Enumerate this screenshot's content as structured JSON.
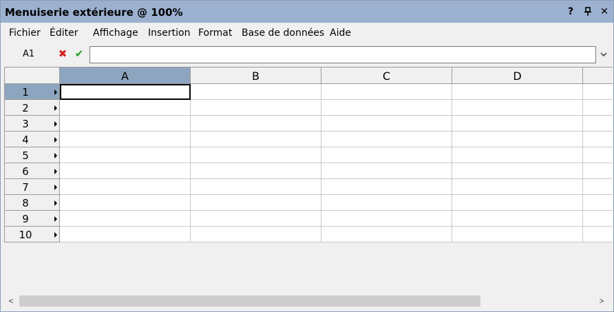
{
  "window": {
    "title": "Menuiserie extérieure @ 100%",
    "help_label": "?",
    "pin_label": "⍑",
    "close_label": "✕"
  },
  "menu": {
    "items": [
      "Fichier",
      "Éditer",
      "Affichage",
      "Insertion",
      "Format",
      "Base de données",
      "Aide"
    ]
  },
  "formula": {
    "cell_ref": "A1",
    "cancel_icon": "✖",
    "confirm_icon": "✔",
    "value": "",
    "dropdown_icon": "⌄"
  },
  "grid": {
    "columns": [
      "A",
      "B",
      "C",
      "D",
      ""
    ],
    "rows": [
      "1",
      "2",
      "3",
      "4",
      "5",
      "6",
      "7",
      "8",
      "9",
      "10"
    ],
    "selected_cell": "A1",
    "selected_column": "A",
    "selected_row": "1"
  },
  "scrollbar": {
    "left_arrow": "<",
    "right_arrow": ">"
  },
  "colors": {
    "titlebar": "#9bb1cf",
    "selected_header": "#8ea5c0",
    "cancel": "#d42020",
    "confirm": "#20a020"
  }
}
